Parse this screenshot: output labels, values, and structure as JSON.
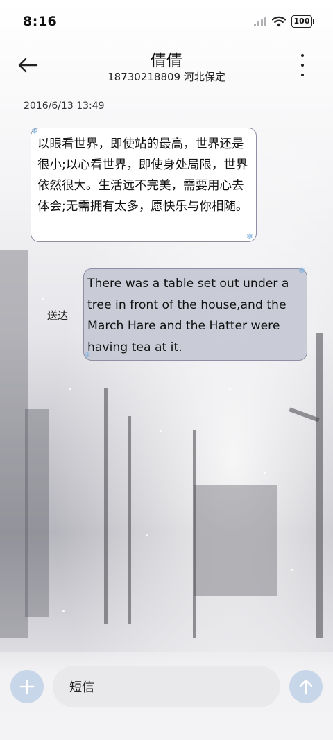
{
  "status_bar": {
    "time": "8:16",
    "battery": "100",
    "icons": [
      "signal-icon",
      "wifi-icon",
      "battery-icon"
    ]
  },
  "header": {
    "contact_name": "倩倩",
    "contact_sub": "18730218809 河北保定",
    "icons": [
      "back-arrow-icon",
      "more-vertical-icon"
    ]
  },
  "conversation": {
    "timestamp": "2016/6/13 13:49",
    "messages": [
      {
        "direction": "incoming",
        "text": "以眼看世界，即使站的最高，世界还是很小;以心看世界，即使身处局限，世界依然很大。生活远不完美，需要用心去体会;无需拥有太多，愿快乐与你相随。"
      },
      {
        "direction": "outgoing",
        "status": "送达",
        "text": "There was a table set out under a tree in front of the house,and the March Hare and the Hatter were having tea at it."
      }
    ]
  },
  "compose": {
    "placeholder": "短信",
    "icons": [
      "plus-icon",
      "send-arrow-icon"
    ],
    "accent_color": "#c7d6e8"
  },
  "colors": {
    "bubble_border": "#8e8ea4",
    "outgoing_bubble": "#c6c8d4",
    "snowflake": "#7fb2dd"
  }
}
